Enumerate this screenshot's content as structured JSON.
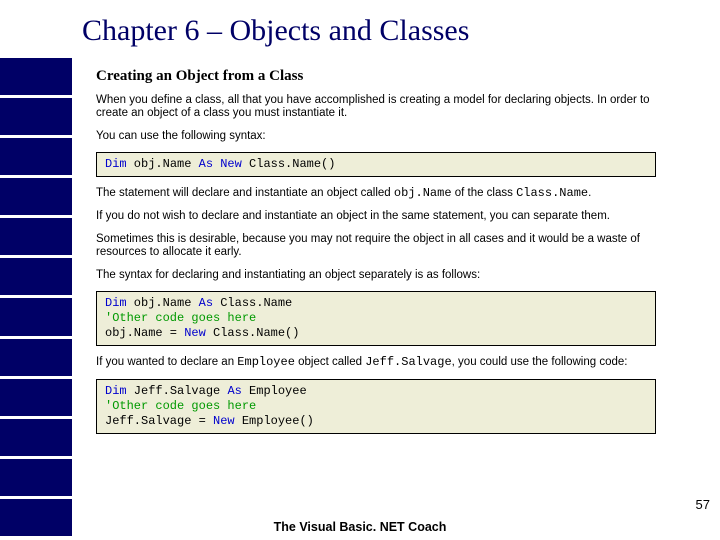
{
  "title": "Chapter 6 – Objects and Classes",
  "subtitle": "Creating an Object from a Class",
  "p1": "When you define a class, all that you have accomplished is creating a model for declaring objects. In order to create an object of a class you must instantiate it.",
  "p2": "You can use the following syntax:",
  "code1": {
    "kw1": "Dim",
    "obj": " obj.Name ",
    "kw2": "As New",
    "cls": " Class.Name()"
  },
  "p3a": "The statement will declare and instantiate an object called ",
  "p3_obj": "obj.Name",
  "p3b": " of the class ",
  "p3_cls": "Class.Name",
  "p3c": ".",
  "p4": "If you do not wish to declare and instantiate an object in the same statement, you can separate them.",
  "p5": "Sometimes this is desirable, because you may not require the object in all cases and it would be a waste of resources to allocate it early.",
  "p6": "The syntax for declaring and instantiating an object separately is as follows:",
  "code2": {
    "l1_kw1": "Dim",
    "l1_mid": " obj.Name ",
    "l1_kw2": "As",
    "l1_end": " Class.Name",
    "l2": "'Other code goes here",
    "l3_a": "obj.Name = ",
    "l3_kw": "New",
    "l3_b": " Class.Name()"
  },
  "p7a": "If you wanted to declare an ",
  "p7_emp": "Employee",
  "p7b": " object called ",
  "p7_jeff": "Jeff.Salvage",
  "p7c": ", you could use the following code:",
  "code3": {
    "l1_kw1": "Dim",
    "l1_mid": " Jeff.Salvage ",
    "l1_kw2": "As",
    "l1_end": " Employee",
    "l2": "'Other code goes here",
    "l3_a": "Jeff.Salvage = ",
    "l3_kw": "New",
    "l3_b": " Employee()"
  },
  "footer": "The Visual Basic. NET Coach",
  "pagenum": "57"
}
